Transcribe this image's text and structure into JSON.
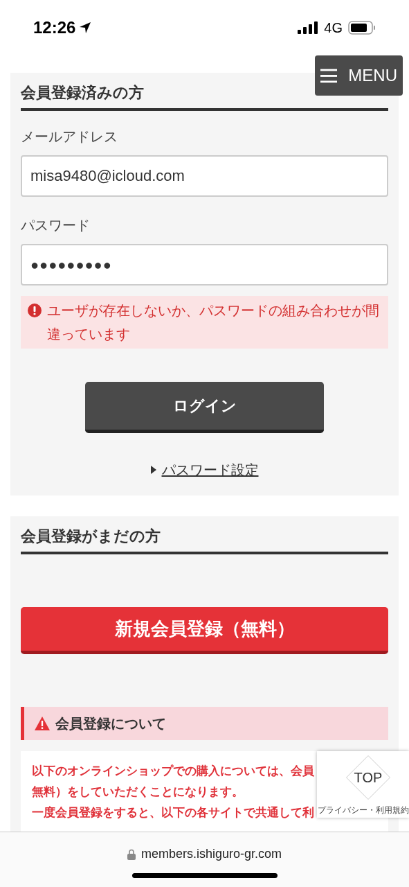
{
  "status_bar": {
    "time": "12:26",
    "network": "4G"
  },
  "menu_button": {
    "label": "MENU"
  },
  "login_section": {
    "title": "会員登録済みの方",
    "email_label": "メールアドレス",
    "email_value": "misa9480@icloud.com",
    "password_label": "パスワード",
    "password_value": "●●●●●●●●●",
    "error": "ユーザが存在しないか、パスワードの組み合わせが間違っています",
    "login_button": "ログイン",
    "password_link": "パスワード設定"
  },
  "register_section": {
    "title": "会員登録がまだの方",
    "register_button": "新規会員登録（無料）",
    "notice_title": "会員登録について",
    "notice_lines": [
      "以下のオンラインショップでの購入については、会員",
      "無料）をしていただくことになります。",
      "一度会員登録をすると、以下の各サイトで共通して利"
    ]
  },
  "top_button": {
    "label": "TOP"
  },
  "recaptcha": {
    "links": "プライバシー・利用規約"
  },
  "browser_bar": {
    "url": "members.ishiguro-gr.com"
  }
}
